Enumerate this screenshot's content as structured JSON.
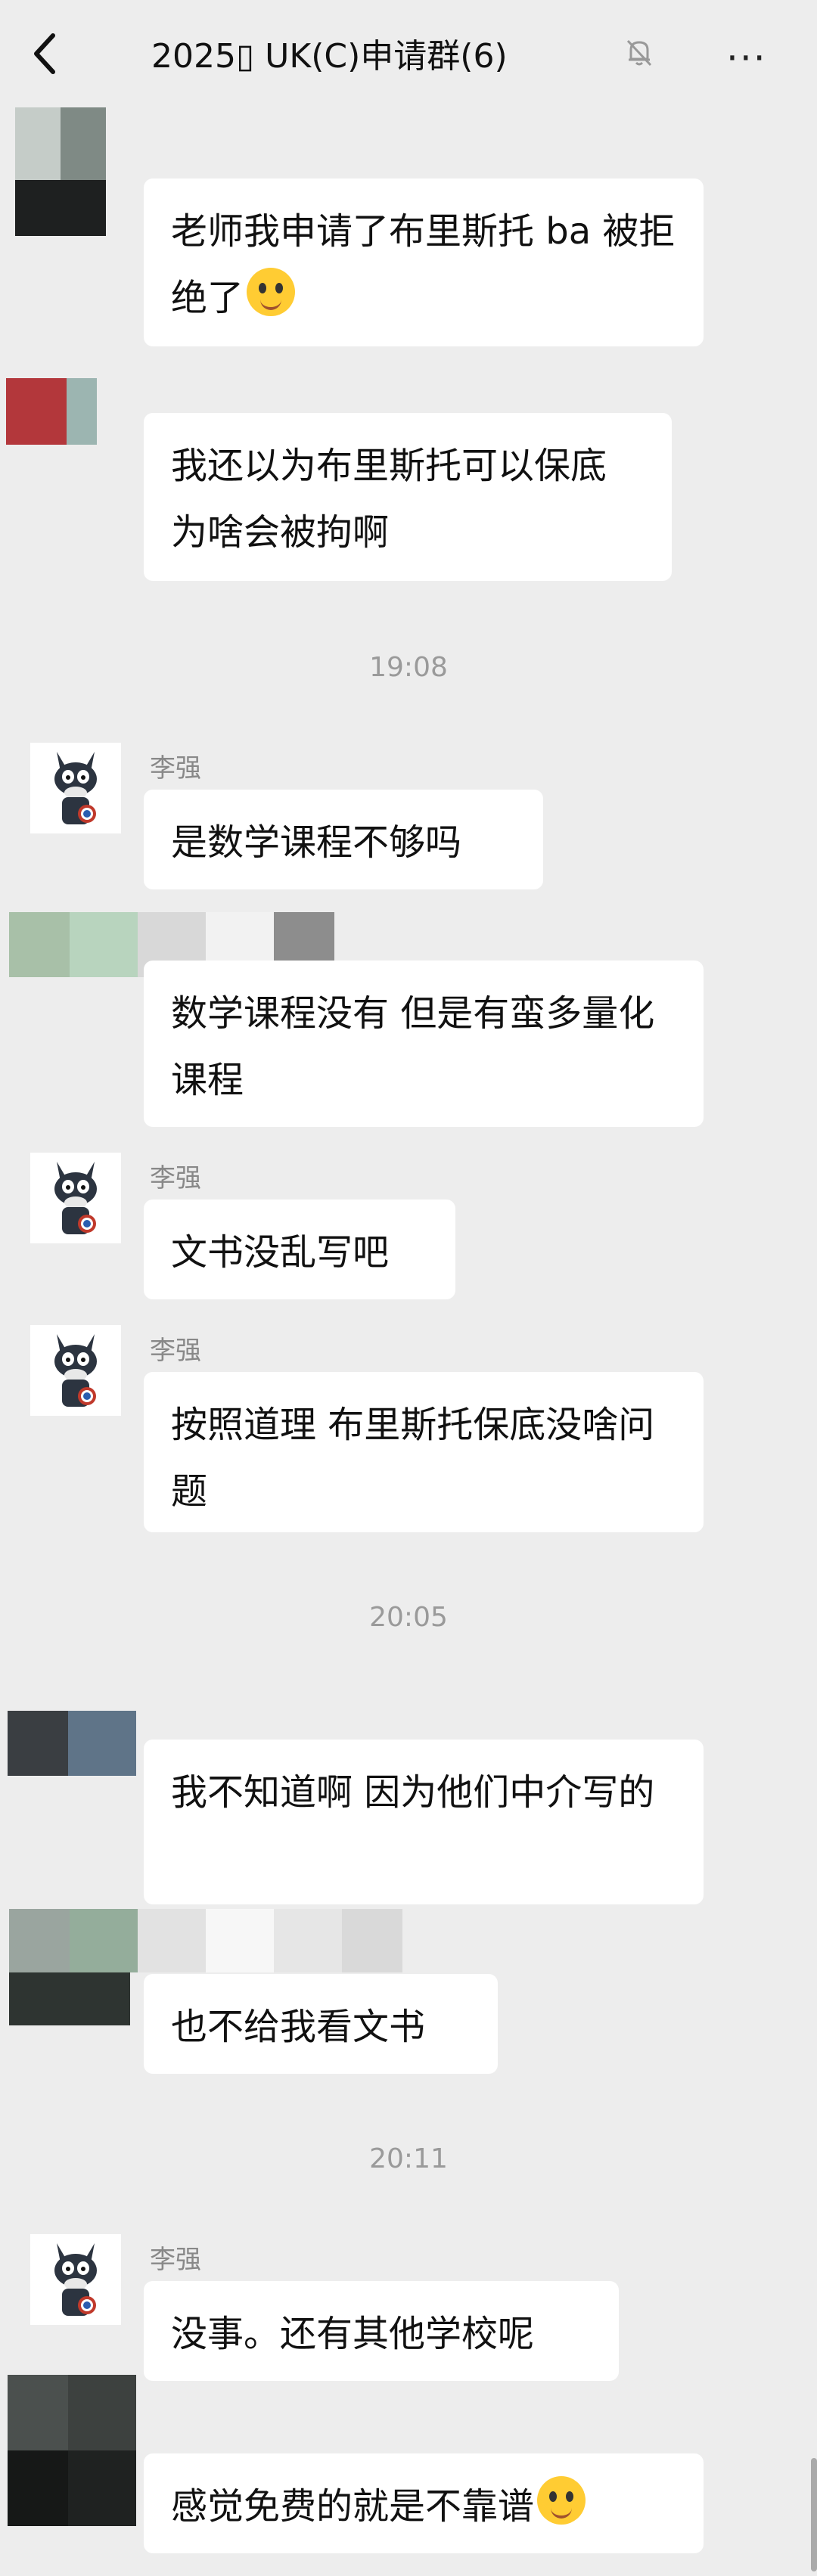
{
  "header": {
    "title": "2025▯ UK(C)申请群(6)",
    "back_icon": "chevron-left-icon",
    "mute_icon": "bell-off-icon",
    "more_label": "···"
  },
  "messages": [
    {
      "text": "老师我申请了布里斯托 ba 被拒绝了"
    },
    {
      "text": "我还以为布里斯托可以保底 为啥会被拘啊"
    },
    {
      "time": "19:08"
    },
    {
      "sender": "李强",
      "text": "是数学课程不够吗"
    },
    {
      "text": "数学课程没有 但是有蛮多量化课程"
    },
    {
      "sender": "李强",
      "text": "文书没乱写吧"
    },
    {
      "sender": "李强",
      "text": "按照道理 布里斯托保底没啥问题"
    },
    {
      "time": "20:05"
    },
    {
      "text": "我不知道啊 因为他们中介写的"
    },
    {
      "text": "也不给我看文书"
    },
    {
      "time": "20:11"
    },
    {
      "sender": "李强",
      "text": "没事。还有其他学校呢"
    },
    {
      "text": "感觉免费的就是不靠谱"
    }
  ],
  "colors": {
    "background": "#ededed",
    "bubble": "#ffffff"
  }
}
